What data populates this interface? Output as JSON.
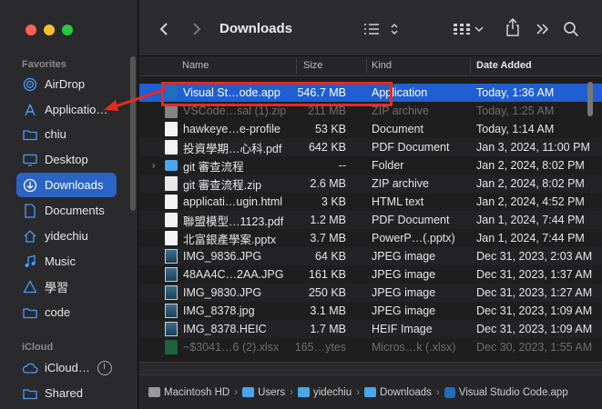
{
  "window": {
    "title": "Downloads"
  },
  "sidebar": {
    "favorites_label": "Favorites",
    "icloud_label": "iCloud",
    "items": [
      {
        "label": "AirDrop",
        "icon": "airdrop-icon"
      },
      {
        "label": "Applicatio…",
        "icon": "applications-icon"
      },
      {
        "label": "chiu",
        "icon": "folder-icon"
      },
      {
        "label": "Desktop",
        "icon": "desktop-icon"
      },
      {
        "label": "Downloads",
        "icon": "downloads-icon",
        "active": true
      },
      {
        "label": "Documents",
        "icon": "document-icon"
      },
      {
        "label": "yidechiu",
        "icon": "home-icon"
      },
      {
        "label": "Music",
        "icon": "music-icon"
      },
      {
        "label": "學習",
        "icon": "folder-icon"
      },
      {
        "label": "code",
        "icon": "folder-icon"
      }
    ],
    "icloud_items": [
      {
        "label": "iCloud…",
        "icon": "icloud-icon"
      },
      {
        "label": "Shared",
        "icon": "shared-icon"
      }
    ]
  },
  "columns": {
    "name": "Name",
    "size": "Size",
    "kind": "Kind",
    "date": "Date Added"
  },
  "files": [
    {
      "name": "Visual St…ode.app",
      "size": "546.7 MB",
      "kind": "Application",
      "date": "Today, 1:36 AM",
      "icon": "vscode-icon",
      "state": "selected"
    },
    {
      "name": "VSCode…sal (1).zip",
      "size": "211 MB",
      "kind": "ZIP archive",
      "date": "Today, 1:25 AM",
      "icon": "zip-icon",
      "state": "dim"
    },
    {
      "name": "hawkeye…e-profile",
      "size": "53 KB",
      "kind": "Document",
      "date": "Today, 1:14 AM",
      "icon": "doc-icon"
    },
    {
      "name": "投資學期…心科.pdf",
      "size": "642 KB",
      "kind": "PDF Document",
      "date": "Jan 3, 2024, 11:00 PM",
      "icon": "pdf-icon"
    },
    {
      "name": "git 審查流程",
      "size": "--",
      "kind": "Folder",
      "date": "Jan 2, 2024, 8:02 PM",
      "icon": "folder-icon",
      "disclosure": "›"
    },
    {
      "name": "git 審查流程.zip",
      "size": "2.6 MB",
      "kind": "ZIP archive",
      "date": "Jan 2, 2024, 8:02 PM",
      "icon": "zip-icon"
    },
    {
      "name": "applicati…ugin.html",
      "size": "3 KB",
      "kind": "HTML text",
      "date": "Jan 2, 2024, 4:52 PM",
      "icon": "html-icon"
    },
    {
      "name": "聯盟模型…1123.pdf",
      "size": "1.2 MB",
      "kind": "PDF Document",
      "date": "Jan 1, 2024, 7:44 PM",
      "icon": "pdf-icon"
    },
    {
      "name": "北富銀產學案.pptx",
      "size": "3.7 MB",
      "kind": "PowerP…(.pptx)",
      "date": "Jan 1, 2024, 7:44 PM",
      "icon": "ppt-icon"
    },
    {
      "name": "IMG_9836.JPG",
      "size": "64 KB",
      "kind": "JPEG image",
      "date": "Dec 31, 2023, 2:03 AM",
      "icon": "image-icon"
    },
    {
      "name": "48AA4C…2AA.JPG",
      "size": "161 KB",
      "kind": "JPEG image",
      "date": "Dec 31, 2023, 1:37 AM",
      "icon": "image-icon"
    },
    {
      "name": "IMG_9830.JPG",
      "size": "250 KB",
      "kind": "JPEG image",
      "date": "Dec 31, 2023, 1:27 AM",
      "icon": "image-icon"
    },
    {
      "name": "IMG_8378.jpg",
      "size": "3.1 MB",
      "kind": "JPEG image",
      "date": "Dec 31, 2023, 1:09 AM",
      "icon": "image-icon"
    },
    {
      "name": "IMG_8378.HEIC",
      "size": "1.7 MB",
      "kind": "HEIF Image",
      "date": "Dec 31, 2023, 1:09 AM",
      "icon": "image-icon"
    },
    {
      "name": "~$3041…6 (2).xlsx",
      "size": "165…ytes",
      "kind": "Micros…k (.xlsx)",
      "date": "Dec 30, 2023, 1:55 AM",
      "icon": "excel-icon",
      "state": "dim"
    }
  ],
  "pathbar": [
    {
      "label": "Macintosh HD",
      "icon": "hard-drive-icon"
    },
    {
      "label": "Users",
      "icon": "folder-icon"
    },
    {
      "label": "yidechiu",
      "icon": "home-icon"
    },
    {
      "label": "Downloads",
      "icon": "folder-icon"
    },
    {
      "label": "Visual Studio Code.app",
      "icon": "vscode-icon"
    }
  ],
  "colors": {
    "selection": "#1f5fd1",
    "sidebar_active": "#2a64c5",
    "annotation": "#e52b20",
    "accent": "#4a9bff"
  }
}
